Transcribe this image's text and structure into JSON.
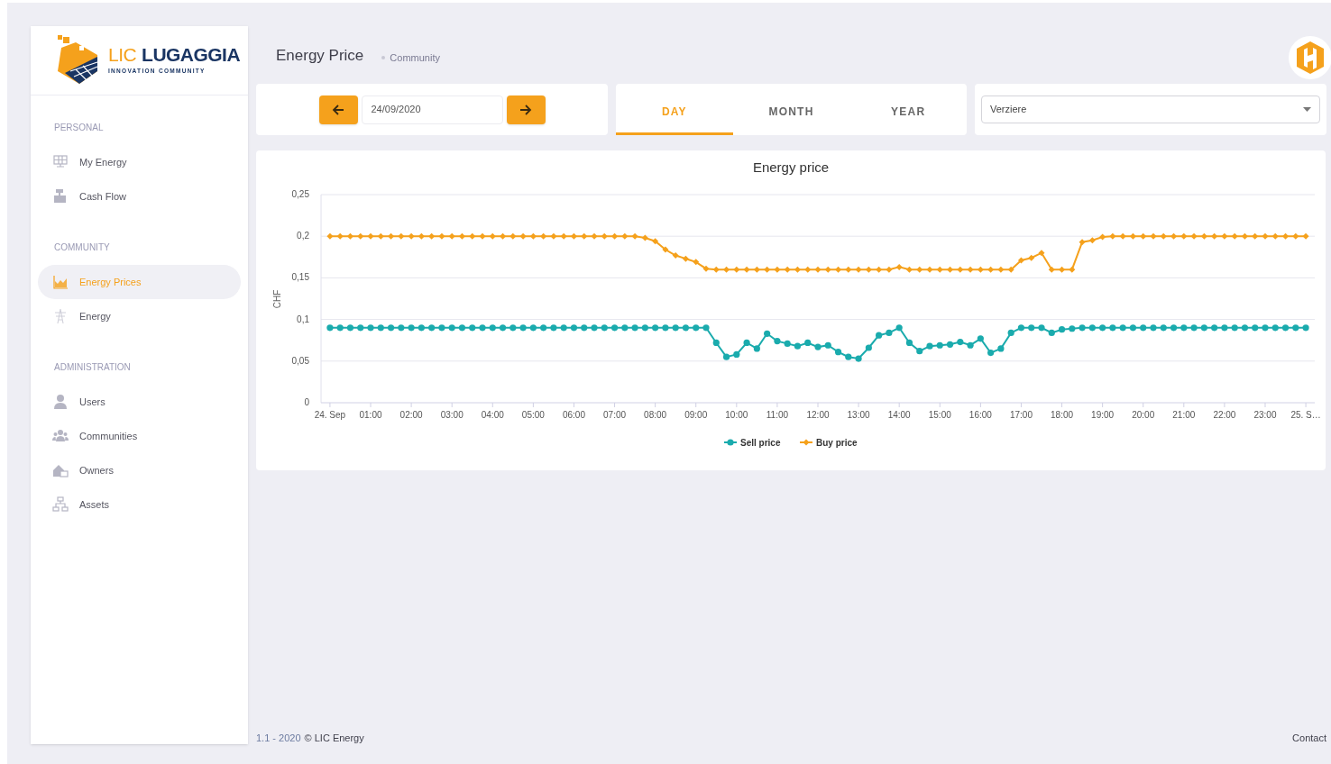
{
  "logo": {
    "name": "LIC",
    "name_2": "LUGAGGIA",
    "tagline": "INNOVATION COMMUNITY"
  },
  "sidebar": {
    "sections": [
      {
        "title": "PERSONAL",
        "items": [
          {
            "label": "My Energy",
            "selected": false
          },
          {
            "label": "Cash Flow",
            "selected": false
          }
        ]
      },
      {
        "title": "COMMUNITY",
        "items": [
          {
            "label": "Energy Prices",
            "selected": true
          },
          {
            "label": "Energy",
            "selected": false
          }
        ]
      },
      {
        "title": "ADMINISTRATION",
        "items": [
          {
            "label": "Users",
            "selected": false
          },
          {
            "label": "Communities",
            "selected": false
          },
          {
            "label": "Owners",
            "selected": false
          },
          {
            "label": "Assets",
            "selected": false
          }
        ]
      }
    ]
  },
  "header": {
    "title": "Energy Price",
    "breadcrumb": "Community"
  },
  "date_nav": {
    "date": "24/09/2020"
  },
  "period_tabs": [
    {
      "label": "DAY",
      "selected": true
    },
    {
      "label": "MONTH",
      "selected": false
    },
    {
      "label": "YEAR",
      "selected": false
    }
  ],
  "site_select": {
    "value": "Verziere"
  },
  "chart": {
    "chart_data": {
      "type": "line",
      "title": "Energy price",
      "ylabel": "CHF",
      "x": [
        0,
        0.25,
        0.5,
        0.75,
        1,
        1.25,
        1.5,
        1.75,
        2,
        2.25,
        2.5,
        2.75,
        3,
        3.25,
        3.5,
        3.75,
        4,
        4.25,
        4.5,
        4.75,
        5,
        5.25,
        5.5,
        5.75,
        6,
        6.25,
        6.5,
        6.75,
        7,
        7.25,
        7.5,
        7.75,
        8,
        8.25,
        8.5,
        8.75,
        9,
        9.25,
        9.5,
        9.75,
        10,
        10.25,
        10.5,
        10.75,
        11,
        11.25,
        11.5,
        11.75,
        12,
        12.25,
        12.5,
        12.75,
        13,
        13.25,
        13.5,
        13.75,
        14,
        14.25,
        14.5,
        14.75,
        15,
        15.25,
        15.5,
        15.75,
        16,
        16.25,
        16.5,
        16.75,
        17,
        17.25,
        17.5,
        17.75,
        18,
        18.25,
        18.5,
        18.75,
        19,
        19.25,
        19.5,
        19.75,
        20,
        20.25,
        20.5,
        20.75,
        21,
        21.25,
        21.5,
        21.75,
        22,
        22.25,
        22.5,
        22.75,
        23,
        23.25,
        23.5,
        23.75,
        24
      ],
      "series": [
        {
          "name": "Sell price",
          "color": "#1aabad",
          "marker": "circle",
          "values": [
            0.09,
            0.09,
            0.09,
            0.09,
            0.09,
            0.09,
            0.09,
            0.09,
            0.09,
            0.09,
            0.09,
            0.09,
            0.09,
            0.09,
            0.09,
            0.09,
            0.09,
            0.09,
            0.09,
            0.09,
            0.09,
            0.09,
            0.09,
            0.09,
            0.09,
            0.09,
            0.09,
            0.09,
            0.09,
            0.09,
            0.09,
            0.09,
            0.09,
            0.09,
            0.09,
            0.09,
            0.09,
            0.09,
            0.072,
            0.055,
            0.058,
            0.072,
            0.065,
            0.083,
            0.074,
            0.071,
            0.068,
            0.072,
            0.067,
            0.069,
            0.061,
            0.055,
            0.053,
            0.066,
            0.081,
            0.084,
            0.09,
            0.072,
            0.062,
            0.068,
            0.069,
            0.07,
            0.073,
            0.069,
            0.077,
            0.06,
            0.065,
            0.084,
            0.09,
            0.09,
            0.09,
            0.084,
            0.088,
            0.089,
            0.09,
            0.09,
            0.09,
            0.09,
            0.09,
            0.09,
            0.09,
            0.09,
            0.09,
            0.09,
            0.09,
            0.09,
            0.09,
            0.09,
            0.09,
            0.09,
            0.09,
            0.09,
            0.09,
            0.09,
            0.09,
            0.09,
            0.09
          ]
        },
        {
          "name": "Buy price",
          "color": "#f5a11c",
          "marker": "diamond",
          "values": [
            0.2,
            0.2,
            0.2,
            0.2,
            0.2,
            0.2,
            0.2,
            0.2,
            0.2,
            0.2,
            0.2,
            0.2,
            0.2,
            0.2,
            0.2,
            0.2,
            0.2,
            0.2,
            0.2,
            0.2,
            0.2,
            0.2,
            0.2,
            0.2,
            0.2,
            0.2,
            0.2,
            0.2,
            0.2,
            0.2,
            0.2,
            0.198,
            0.194,
            0.184,
            0.177,
            0.173,
            0.169,
            0.161,
            0.16,
            0.16,
            0.16,
            0.16,
            0.16,
            0.16,
            0.16,
            0.16,
            0.16,
            0.16,
            0.16,
            0.16,
            0.16,
            0.16,
            0.16,
            0.16,
            0.16,
            0.16,
            0.163,
            0.16,
            0.16,
            0.16,
            0.16,
            0.16,
            0.16,
            0.16,
            0.16,
            0.16,
            0.16,
            0.16,
            0.171,
            0.174,
            0.18,
            0.16,
            0.16,
            0.16,
            0.193,
            0.195,
            0.199,
            0.2,
            0.2,
            0.2,
            0.2,
            0.2,
            0.2,
            0.2,
            0.2,
            0.2,
            0.2,
            0.2,
            0.2,
            0.2,
            0.2,
            0.2,
            0.2,
            0.2,
            0.2,
            0.2,
            0.2
          ]
        }
      ],
      "xlim": [
        -0.22,
        24.22
      ],
      "ylim": [
        0,
        0.25
      ],
      "grid": "y",
      "legend": "bottom",
      "xticks": [
        {
          "value": 0,
          "label": "24. Sep"
        },
        {
          "value": 1,
          "label": "01:00"
        },
        {
          "value": 2,
          "label": "02:00"
        },
        {
          "value": 3,
          "label": "03:00"
        },
        {
          "value": 4,
          "label": "04:00"
        },
        {
          "value": 5,
          "label": "05:00"
        },
        {
          "value": 6,
          "label": "06:00"
        },
        {
          "value": 7,
          "label": "07:00"
        },
        {
          "value": 8,
          "label": "08:00"
        },
        {
          "value": 9,
          "label": "09:00"
        },
        {
          "value": 10,
          "label": "10:00"
        },
        {
          "value": 11,
          "label": "11:00"
        },
        {
          "value": 12,
          "label": "12:00"
        },
        {
          "value": 13,
          "label": "13:00"
        },
        {
          "value": 14,
          "label": "14:00"
        },
        {
          "value": 15,
          "label": "15:00"
        },
        {
          "value": 16,
          "label": "16:00"
        },
        {
          "value": 17,
          "label": "17:00"
        },
        {
          "value": 18,
          "label": "18:00"
        },
        {
          "value": 19,
          "label": "19:00"
        },
        {
          "value": 20,
          "label": "20:00"
        },
        {
          "value": 21,
          "label": "21:00"
        },
        {
          "value": 22,
          "label": "22:00"
        },
        {
          "value": 23,
          "label": "23:00"
        },
        {
          "value": 24,
          "label": "25. S…"
        }
      ],
      "yticks": [
        {
          "value": 0,
          "label": "0"
        },
        {
          "value": 0.05,
          "label": "0,05"
        },
        {
          "value": 0.1,
          "label": "0,1"
        },
        {
          "value": 0.15,
          "label": "0,15"
        },
        {
          "value": 0.2,
          "label": "0,2"
        },
        {
          "value": 0.25,
          "label": "0,25"
        }
      ]
    }
  },
  "footer": {
    "version": "1.1 - 2020",
    "copyright": "© LIC Energy",
    "contact": "Contact"
  }
}
